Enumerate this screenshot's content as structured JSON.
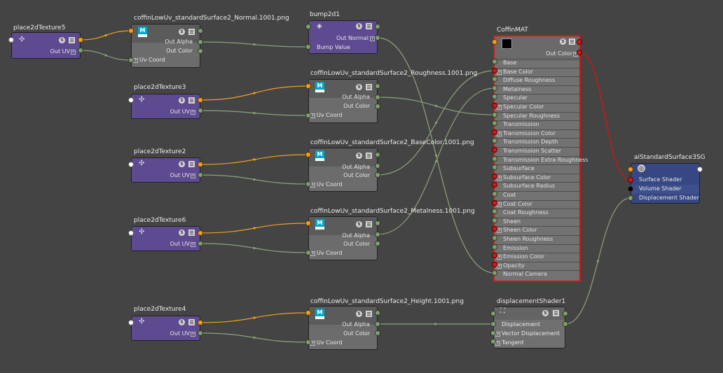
{
  "colors": {
    "background": "#444444",
    "purple_node": "#5d4a90",
    "file_node": "#6c6c6c",
    "material_node": "#727272",
    "selected_border": "#dd1111",
    "sg_node": "#364783",
    "wire_green": "#8aa37a",
    "wire_orange": "#f0a020",
    "wire_red": "#d41414"
  },
  "nodes": {
    "p5": {
      "title": "place2dTexture5",
      "out": "Out UV"
    },
    "p3": {
      "title": "place2dTexture3",
      "out": "Out UV"
    },
    "p2": {
      "title": "place2dTexture2",
      "out": "Out UV"
    },
    "p6": {
      "title": "place2dTexture6",
      "out": "Out UV"
    },
    "p4": {
      "title": "place2dTexture4",
      "out": "Out UV"
    },
    "fn": {
      "title": "coffinLowUv_standardSurface2_Normal.1001.png",
      "out_alpha": "Out Alpha",
      "out_color": "Out Color",
      "uv": "Uv Coord"
    },
    "fr": {
      "title": "coffinLowUv_standardSurface2_Roughness.1001.png",
      "out_alpha": "Out Alpha",
      "out_color": "Out Color",
      "uv": "Uv Coord"
    },
    "fb": {
      "title": "coffinLowUv_standardSurface2_BaseColor.1001.png",
      "out_alpha": "Out Alpha",
      "out_color": "Out Color",
      "uv": "Uv Coord"
    },
    "fm": {
      "title": "coffinLowUv_standardSurface2_Metalness.1001.png",
      "out_alpha": "Out Alpha",
      "out_color": "Out Color",
      "uv": "Uv Coord"
    },
    "fh": {
      "title": "coffinLowUv_standardSurface2_Height.1001.png",
      "out_alpha": "Out Alpha",
      "out_color": "Out Color",
      "uv": "Uv Coord"
    },
    "bump": {
      "title": "bump2d1",
      "out": "Out Normal",
      "in": "Bump Value"
    },
    "mat": {
      "title": "CoffinMAT",
      "out": "Out Color",
      "attrs": [
        "Base",
        "Base Color",
        "Diffuse Roughness",
        "Metalness",
        "Specular",
        "Specular Color",
        "Specular Roughness",
        "Transmission",
        "Transmission Color",
        "Transmission Depth",
        "Transmission Scatter",
        "Transmission Extra Roughness",
        "Subsurface",
        "Subsurface Color",
        "Subsurface Radius",
        "Coat",
        "Coat Color",
        "Coat Roughness",
        "Sheen",
        "Sheen Color",
        "Sheen Roughness",
        "Emission",
        "Emission Color",
        "Opacity",
        "Normal Camera"
      ]
    },
    "sg": {
      "title": "aiStandardSurface3SG",
      "attrs": [
        "Surface Shader",
        "Volume Shader",
        "Displacement Shader"
      ]
    },
    "disp": {
      "title": "displacementShader1",
      "attrs": [
        "Displacement",
        "Vector Displacement",
        "Tangent"
      ]
    }
  }
}
